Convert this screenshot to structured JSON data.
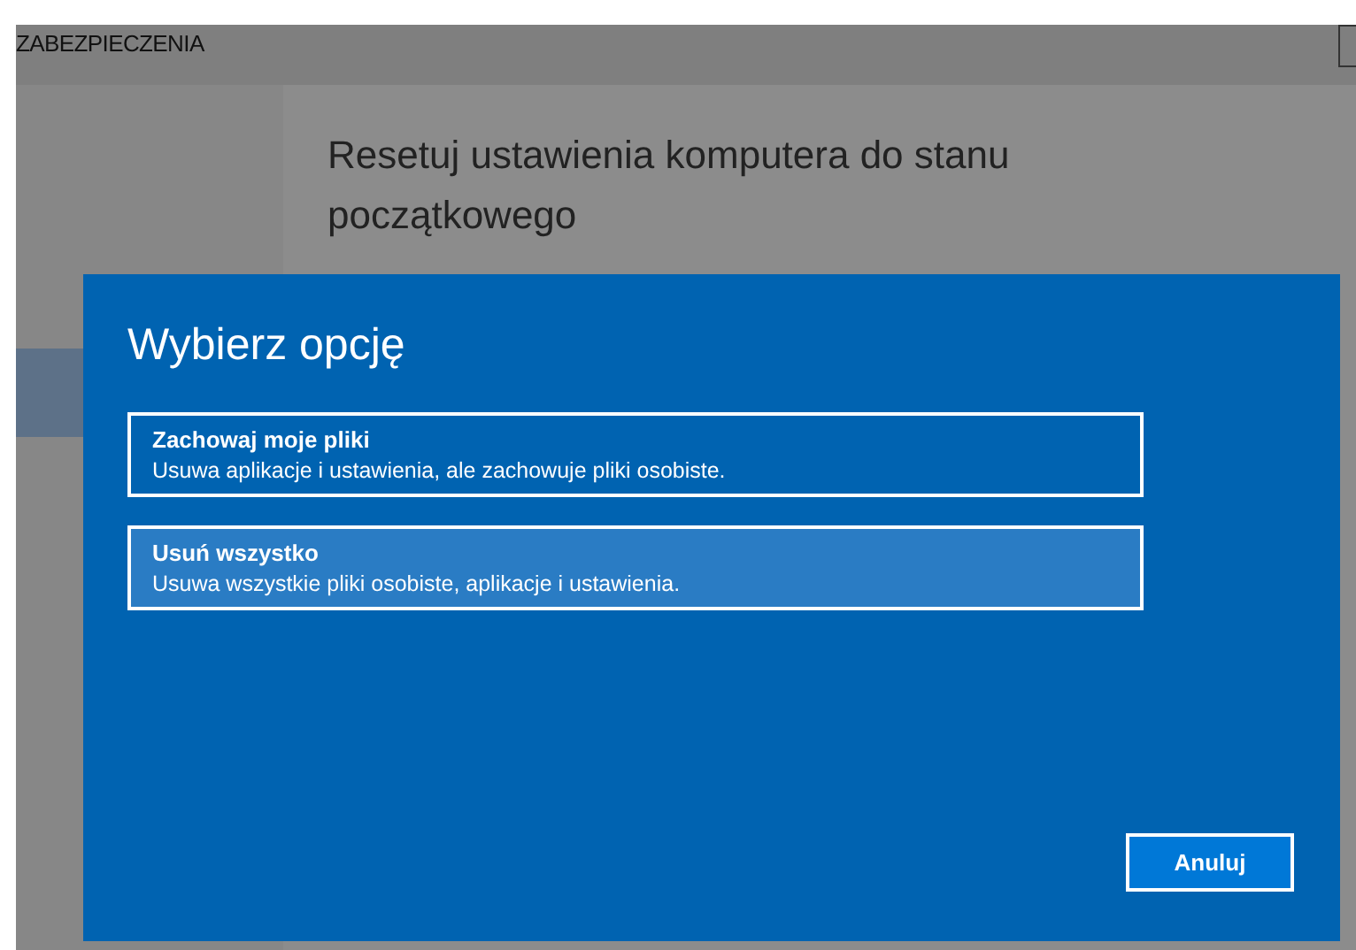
{
  "header": {
    "title": "ZABEZPIECZENIA"
  },
  "page": {
    "heading": "Resetuj ustawienia komputera do stanu początkowego"
  },
  "dialog": {
    "title": "Wybierz opcję",
    "options": [
      {
        "title": "Zachowaj moje pliki",
        "description": "Usuwa aplikacje i ustawienia, ale zachowuje pliki osobiste.",
        "selected": false
      },
      {
        "title": "Usuń wszystko",
        "description": "Usuwa wszystkie pliki osobiste, aplikacje i ustawienia.",
        "selected": true
      }
    ],
    "buttons": [
      "Anuluj"
    ]
  }
}
